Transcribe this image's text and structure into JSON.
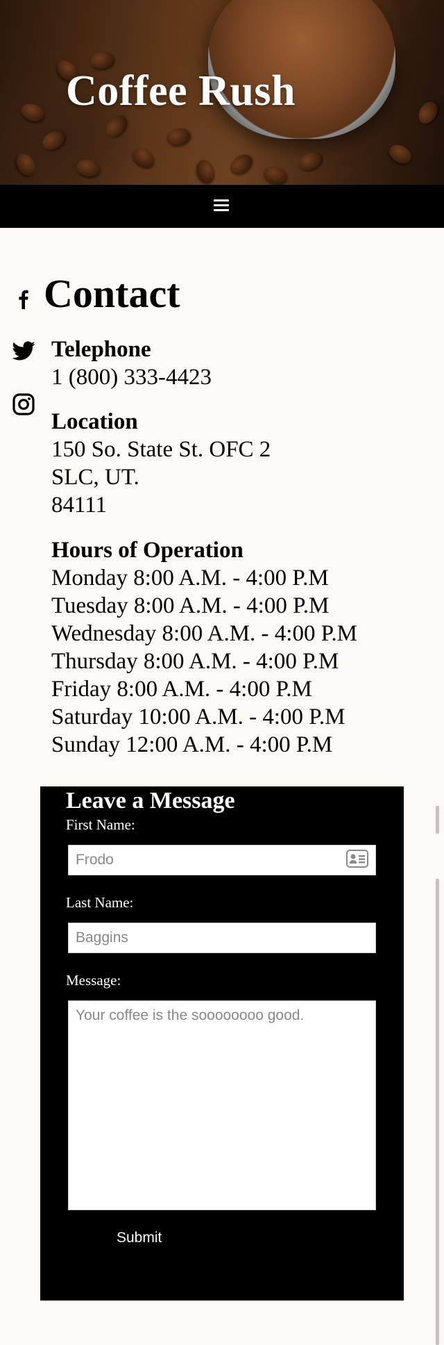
{
  "header": {
    "site_title": "Coffee Rush",
    "menu_icon": "hamburger-menu-icon"
  },
  "social": [
    {
      "name": "facebook",
      "icon": "facebook-icon"
    },
    {
      "name": "twitter",
      "icon": "twitter-icon"
    },
    {
      "name": "instagram",
      "icon": "instagram-icon"
    }
  ],
  "contact": {
    "heading": "Contact",
    "telephone": {
      "label": "Telephone",
      "value": "1 (800) 333-4423"
    },
    "location": {
      "label": "Location",
      "lines": [
        "150 So. State St. OFC 2",
        "SLC, UT.",
        "84111"
      ]
    },
    "hours": {
      "label": "Hours of Operation",
      "lines": [
        "Monday 8:00 A.M. - 4:00 P.M",
        "Tuesday 8:00 A.M. - 4:00 P.M",
        "Wednesday 8:00 A.M. - 4:00 P.M",
        "Thursday 8:00 A.M. - 4:00 P.M",
        "Friday 8:00 A.M. - 4:00 P.M",
        "Saturday 10:00 A.M. - 4:00 P.M",
        "Sunday 12:00 A.M. - 4:00 P.M"
      ]
    }
  },
  "form": {
    "title": "Leave a Message",
    "first_name": {
      "label": "First Name:",
      "value": "",
      "placeholder": "Frodo"
    },
    "last_name": {
      "label": "Last Name:",
      "value": "",
      "placeholder": "Baggins"
    },
    "message": {
      "label": "Message:",
      "value": "",
      "placeholder": "Your coffee is the soooooooo good."
    },
    "submit_label": "Submit",
    "autofill_icon": "contact-card-icon"
  },
  "colors": {
    "page_background": "#fcf9f4",
    "nav_background": "#000000",
    "form_background": "#000000",
    "title_text": "#ffffff"
  }
}
